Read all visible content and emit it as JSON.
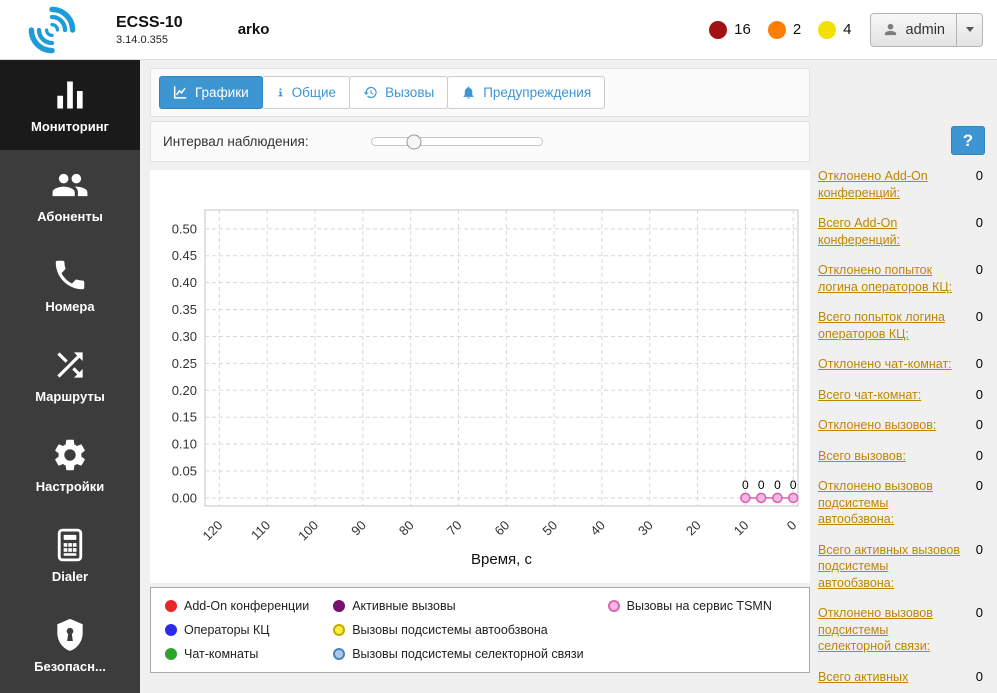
{
  "header": {
    "app_name": "ECSS-10",
    "version": "3.14.0.355",
    "system_name": "arko",
    "alarm_counters": [
      {
        "name": "critical",
        "color": "#a31212",
        "count": "16"
      },
      {
        "name": "major",
        "color": "#ff7d00",
        "count": "2"
      },
      {
        "name": "minor",
        "color": "#f2e000",
        "count": "4"
      }
    ],
    "user_menu": {
      "label": "admin"
    }
  },
  "sidebar": {
    "items": [
      {
        "id": "monitoring",
        "label": "Мониторинг",
        "icon": "bar-chart",
        "active": true
      },
      {
        "id": "subscribers",
        "label": "Абоненты",
        "icon": "users",
        "active": false
      },
      {
        "id": "numbers",
        "label": "Номера",
        "icon": "phone",
        "active": false
      },
      {
        "id": "routes",
        "label": "Маршруты",
        "icon": "shuffle",
        "active": false
      },
      {
        "id": "settings",
        "label": "Настройки",
        "icon": "gear",
        "active": false
      },
      {
        "id": "dialer",
        "label": "Dialer",
        "icon": "dialer",
        "active": false
      },
      {
        "id": "security",
        "label": "Безопасн...",
        "icon": "shield",
        "active": false
      }
    ]
  },
  "tabs": [
    {
      "id": "graphs",
      "label": "Графики",
      "icon": "chart-line",
      "active": true
    },
    {
      "id": "general",
      "label": "Общие",
      "icon": "info",
      "active": false
    },
    {
      "id": "calls",
      "label": "Вызовы",
      "icon": "history",
      "active": false
    },
    {
      "id": "warnings",
      "label": "Предупреждения",
      "icon": "bell",
      "active": false
    }
  ],
  "toolbar": {
    "interval_label": "Интервал наблюдения:",
    "slider_position_percent": 25,
    "help_button_label": "?"
  },
  "chart_data": {
    "type": "line",
    "xlabel": "Время, с",
    "x_ticks": [
      120,
      110,
      100,
      90,
      80,
      70,
      60,
      50,
      40,
      30,
      20,
      10,
      0
    ],
    "y_ticks": [
      "0.00",
      "0.05",
      "0.10",
      "0.15",
      "0.20",
      "0.25",
      "0.30",
      "0.35",
      "0.40",
      "0.45",
      "0.50"
    ],
    "x_axis_reversed": true,
    "x_range_left_to_right": [
      123,
      -1
    ],
    "y_range": [
      -0.015,
      0.535
    ],
    "grid": "dashed",
    "legend_position": "bottom",
    "series": [
      {
        "name": "Add-On конференции",
        "color": "#e8252b",
        "fill": "#e8252b",
        "x": [],
        "y": []
      },
      {
        "name": "Операторы КЦ",
        "color": "#2b2bea",
        "fill": "#2b2bea",
        "x": [],
        "y": []
      },
      {
        "name": "Чат-комнаты",
        "color": "#2ca42c",
        "fill": "#2ca42c",
        "x": [],
        "y": []
      },
      {
        "name": "Активные вызовы",
        "color": "#76106d",
        "fill": "#76106d",
        "x": [],
        "y": []
      },
      {
        "name": "Вызовы подсистемы автообзвона",
        "color": "#c3ab00",
        "fill": "#f9ee3a",
        "x": [],
        "y": []
      },
      {
        "name": "Вызовы подсистемы селекторной связи",
        "color": "#4f81bd",
        "fill": "#a9c9e8",
        "x": [],
        "y": []
      },
      {
        "name": "Вызовы на сервис TSMN",
        "color": "#d965b5",
        "fill": "#f7b6e3",
        "x": [
          10,
          6.7,
          3.3,
          0
        ],
        "y": [
          0,
          0,
          0,
          0
        ],
        "point_labels": [
          "0",
          "0",
          "0",
          "0"
        ]
      }
    ]
  },
  "stats": [
    {
      "label": "Отклонено Add-On конференций:",
      "value": "0"
    },
    {
      "label": "Всего Add-On конференций:",
      "value": "0"
    },
    {
      "label": "Отклонено попыток логина операторов КЦ:",
      "value": "0"
    },
    {
      "label": "Всего попыток логина операторов КЦ:",
      "value": "0"
    },
    {
      "label": "Отклонено чат-комнат:",
      "value": "0"
    },
    {
      "label": "Всего чат-комнат:",
      "value": "0"
    },
    {
      "label": "Отклонено вызовов:",
      "value": "0"
    },
    {
      "label": "Всего вызовов:",
      "value": "0"
    },
    {
      "label": "Отклонено вызовов подсистемы автообзвона:",
      "value": "0"
    },
    {
      "label": "Всего активных вызовов подсистемы автообзвона:",
      "value": "0"
    },
    {
      "label": "Отклонено вызовов подсистемы селекторной связи:",
      "value": "0"
    },
    {
      "label": "Всего активных",
      "value": "0"
    }
  ]
}
